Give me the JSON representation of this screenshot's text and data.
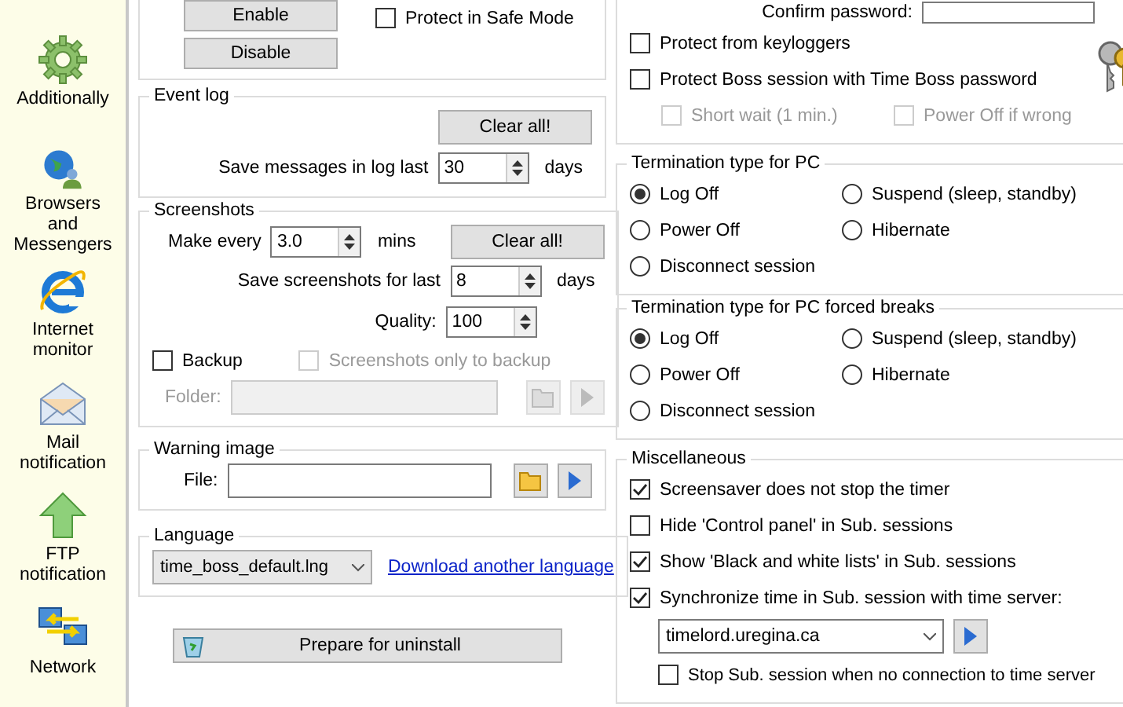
{
  "sidebar": {
    "items": [
      {
        "label": "Additionally",
        "kind": "gear"
      },
      {
        "label": "Browsers and Messengers",
        "kind": "globe"
      },
      {
        "label": "Internet monitor",
        "kind": "browser"
      },
      {
        "label": "Mail notification",
        "kind": "mail"
      },
      {
        "label": "FTP notification",
        "kind": "arrow"
      },
      {
        "label": "Network",
        "kind": "network"
      }
    ]
  },
  "protection": {
    "buttons": [
      "Enable",
      "Disable"
    ],
    "safe_mode": {
      "label": "Protect in Safe Mode",
      "checked": false
    }
  },
  "event_log": {
    "title": "Event log",
    "clear_button": "Clear all!",
    "save_label": "Save messages in log last",
    "value": "30",
    "unit": "days"
  },
  "screenshots": {
    "title": "Screenshots",
    "make_every_label": "Make every",
    "interval": "3.0",
    "interval_unit": "mins",
    "clear_button": "Clear all!",
    "save_label": "Save screenshots for last",
    "save_value": "8",
    "save_unit": "days",
    "quality_label": "Quality:",
    "quality_value": "100",
    "backup": {
      "label": "Backup",
      "checked": false,
      "disabled": false
    },
    "only_backup": {
      "label": "Screenshots only to backup",
      "checked": false,
      "disabled": true
    },
    "folder_label": "Folder:"
  },
  "warning_image": {
    "title": "Warning image",
    "file_label": "File:"
  },
  "language": {
    "title": "Language",
    "selected_value": "time_boss_default.lng",
    "link": "Download another language"
  },
  "uninstall_button": "Prepare for uninstall",
  "password": {
    "confirm_label": "Confirm password:",
    "checks": [
      {
        "label": "Protect from keyloggers",
        "checked": false,
        "disabled": false
      },
      {
        "label": "Protect Boss session with Time Boss password",
        "checked": false,
        "disabled": false
      }
    ],
    "sub_checks": [
      {
        "label": "Short wait (1 min.)",
        "checked": false,
        "disabled": true
      },
      {
        "label": "Power Off if wrong",
        "checked": false,
        "disabled": true
      }
    ]
  },
  "termination_groups": [
    {
      "title": "Termination type for PC",
      "options": [
        {
          "label": "Log Off",
          "selected": true
        },
        {
          "label": "Suspend (sleep, standby)",
          "selected": false
        },
        {
          "label": "Power Off",
          "selected": false
        },
        {
          "label": "Hibernate",
          "selected": false
        },
        {
          "label": "Disconnect session",
          "selected": false
        }
      ]
    },
    {
      "title": "Termination type for PC forced breaks",
      "options": [
        {
          "label": "Log Off",
          "selected": true
        },
        {
          "label": "Suspend (sleep, standby)",
          "selected": false
        },
        {
          "label": "Power Off",
          "selected": false
        },
        {
          "label": "Hibernate",
          "selected": false
        },
        {
          "label": "Disconnect session",
          "selected": false
        }
      ]
    }
  ],
  "miscellaneous": {
    "title": "Miscellaneous",
    "checks": [
      {
        "label": "Screensaver does not stop the timer",
        "checked": true,
        "disabled": false
      },
      {
        "label": "Hide 'Control panel' in Sub. sessions",
        "checked": false,
        "disabled": false
      },
      {
        "label": "Show 'Black and white lists' in Sub. sessions",
        "checked": true,
        "disabled": false
      },
      {
        "label": "Synchronize time in Sub. session with time server:",
        "checked": true,
        "disabled": false
      }
    ],
    "server": "timelord.uregina.ca",
    "stop_check": {
      "label": "Stop Sub. session when no connection to time server",
      "checked": false,
      "disabled": false
    }
  }
}
